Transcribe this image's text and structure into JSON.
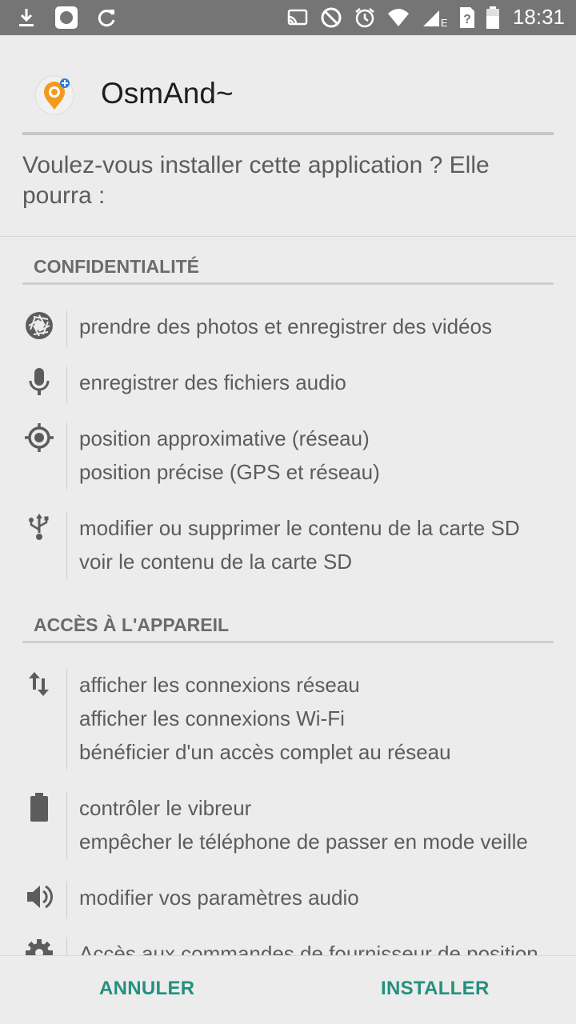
{
  "status_bar": {
    "time": "18:31",
    "network_label": "E",
    "left_icons": [
      "download-icon",
      "app-notification-icon",
      "sync-icon"
    ],
    "right_icons": [
      "cast-icon",
      "do-not-disturb-icon",
      "alarm-icon",
      "wifi-icon",
      "signal-icon",
      "sim-unknown-icon",
      "battery-icon"
    ]
  },
  "app": {
    "name": "OsmAnd~",
    "icon": "osmand-logo-icon",
    "accent_color": "#f39a1e"
  },
  "prompt": {
    "question": "Voulez-vous installer cette application ? Elle pourra :"
  },
  "sections": {
    "privacy": {
      "title": "CONFIDENTIALITÉ",
      "items": [
        {
          "icon": "camera-shutter-icon",
          "lines": [
            "prendre des photos et enregistrer des vidéos"
          ]
        },
        {
          "icon": "microphone-icon",
          "lines": [
            "enregistrer des fichiers audio"
          ]
        },
        {
          "icon": "location-target-icon",
          "lines": [
            "position approximative (réseau)",
            "position précise (GPS et réseau)"
          ]
        },
        {
          "icon": "usb-icon",
          "lines": [
            "modifier ou supprimer le contenu de la carte SD",
            "voir le contenu de la carte SD"
          ]
        }
      ]
    },
    "device": {
      "title": "ACCÈS À L'APPAREIL",
      "items": [
        {
          "icon": "network-arrows-icon",
          "lines": [
            "afficher les connexions réseau",
            "afficher les connexions Wi-Fi",
            "bénéficier d'un accès complet au réseau"
          ]
        },
        {
          "icon": "battery-icon",
          "lines": [
            "contrôler le vibreur",
            "empêcher le téléphone de passer en mode veille"
          ]
        },
        {
          "icon": "volume-icon",
          "lines": [
            "modifier vos paramètres audio"
          ]
        },
        {
          "icon": "settings-gear-icon",
          "lines": [
            "Accès aux commandes de fournisseur de position"
          ]
        }
      ]
    }
  },
  "buttons": {
    "cancel": "ANNULER",
    "install": "INSTALLER",
    "color": "#23907e"
  }
}
